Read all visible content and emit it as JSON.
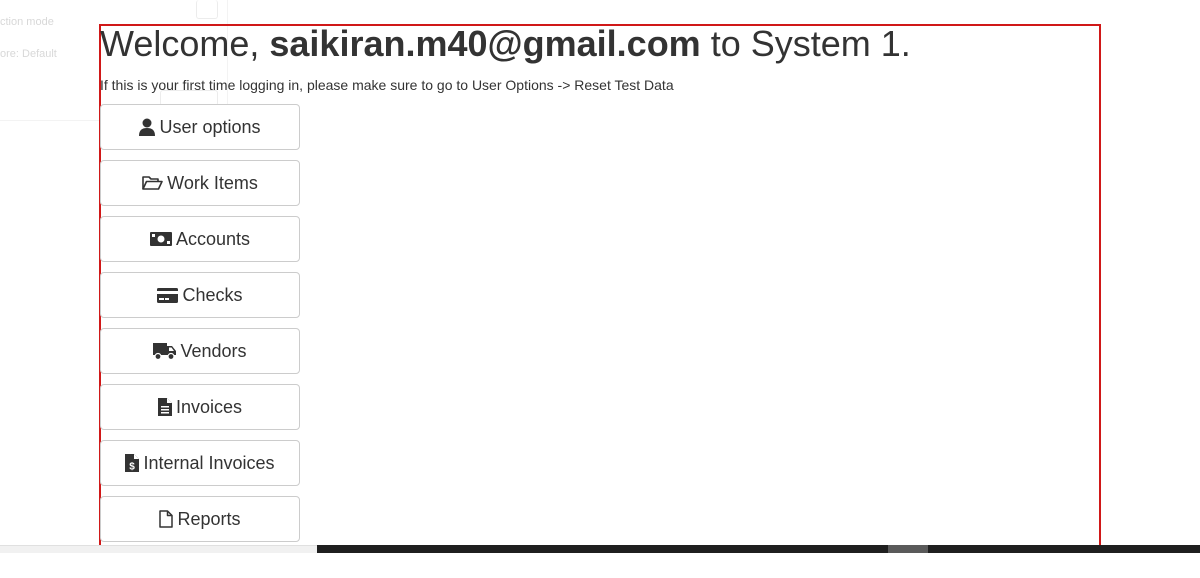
{
  "background_panel": {
    "line1": "ction mode",
    "line2": "ore: Default"
  },
  "welcome": {
    "prefix": "Welcome, ",
    "email": "saikiran.m40@gmail.com",
    "suffix": " to System 1."
  },
  "notice": "If this is your first time logging in, please make sure to go to User Options -> Reset Test Data",
  "menu": {
    "items": [
      {
        "label": "User options",
        "icon": "user-icon"
      },
      {
        "label": "Work Items",
        "icon": "folder-open-icon"
      },
      {
        "label": "Accounts",
        "icon": "money-bill-icon"
      },
      {
        "label": "Checks",
        "icon": "credit-card-icon"
      },
      {
        "label": "Vendors",
        "icon": "truck-icon"
      },
      {
        "label": "Invoices",
        "icon": "file-text-icon"
      },
      {
        "label": "Internal Invoices",
        "icon": "file-invoice-dollar-icon"
      },
      {
        "label": "Reports",
        "icon": "file-outline-icon"
      }
    ]
  },
  "colors": {
    "frame_border": "#d01818",
    "text": "#333333",
    "button_border": "#cccccc"
  }
}
